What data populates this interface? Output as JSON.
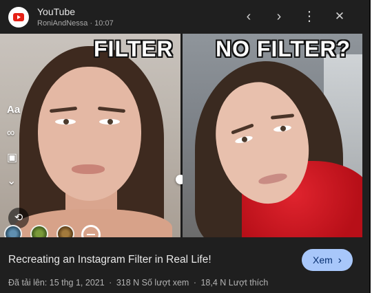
{
  "notification": {
    "app_name": "YouTube",
    "channel": "RoniAndNessa",
    "time": "10:07",
    "app_icon": "youtube-play-icon"
  },
  "header_controls": {
    "prev_icon": "‹",
    "next_icon": "›",
    "more_icon": "⋮",
    "close_icon": "✕"
  },
  "thumbnail": {
    "left_caption": "FILTER",
    "right_caption": "NO FILTER?",
    "ig_tools": [
      "Aa",
      "∞",
      "▣",
      "⌄"
    ],
    "camera_icon": "⟲"
  },
  "video": {
    "title": "Recreating an Instagram Filter in Real Life!",
    "uploaded_label": "Đã tải lên: 15 thg 1, 2021",
    "views_label": "318 N Số lượt xem",
    "likes_label": "18,4 N Lượt thích",
    "separator": "·"
  },
  "actions": {
    "view_label": "Xem",
    "view_icon": "›"
  },
  "colors": {
    "card_bg": "#1f1f1f",
    "button_bg": "#a8c7fa",
    "youtube_red": "#e62117",
    "sweater_red": "#c8141e"
  }
}
